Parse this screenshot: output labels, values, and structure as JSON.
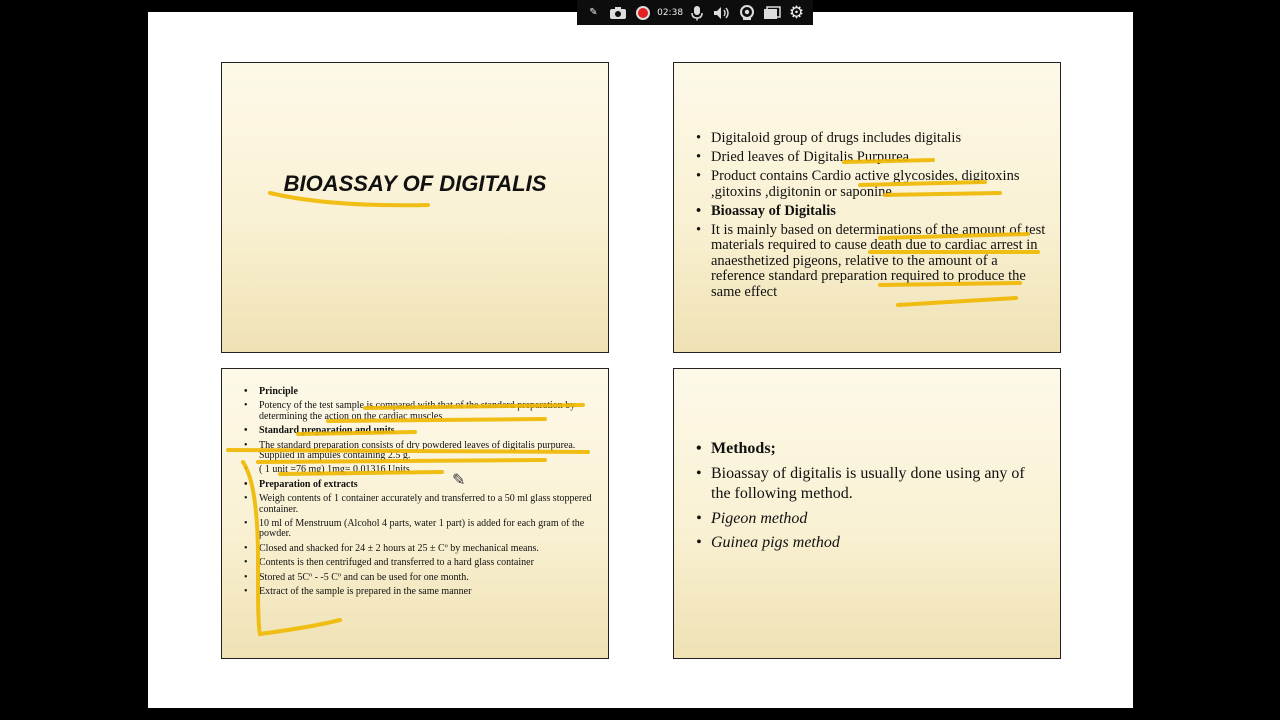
{
  "toolbar": {
    "timer": "02:38"
  },
  "slide1": {
    "title": "BIOASSAY OF DIGITALIS"
  },
  "slide2": {
    "bullets": [
      "Digitaloid group of drugs includes digitalis",
      "Dried leaves of Digitalis Purpurea",
      "Product contains Cardio active glycosides, digitoxins ,gitoxins ,digitonin or saponine",
      "Bioassay of Digitalis",
      "It is mainly based on determinations of the amount of test materials required to cause death due to cardiac arrest in anaesthetized pigeons, relative to the amount of a reference standard preparation required to produce the same effect"
    ]
  },
  "slide3": {
    "bullets": [
      "Principle",
      "Potency of the test sample is compared with that of the standard preparation by determining the action on the cardiac muscles",
      "Standard preparation and units",
      "The standard preparation  consists of dry powdered leaves of digitalis purpurea. Supplied in ampules containing 2.5 g.",
      "( 1 unit =76 mg) 1mg= 0.01316 Units",
      "Preparation of extracts",
      "Weigh contents of 1 container accurately  and transferred to a 50 ml glass stoppered container.",
      "10 ml of Menstruum (Alcohol 4 parts, water 1 part) is added for each gram of the powder.",
      "Closed and shacked for 24 ± 2 hours at 25 ±  Cº by mechanical means.",
      "Contents is then centrifuged and transferred to a hard glass container",
      "Stored at 5Cº - -5 Cº and can be used for one month.",
      "Extract of the sample is prepared in the same manner"
    ]
  },
  "slide4": {
    "bullets": [
      "Methods;",
      "Bioassay of digitalis is usually done using any of the following method.",
      "Pigeon method",
      "Guinea pigs method"
    ]
  }
}
